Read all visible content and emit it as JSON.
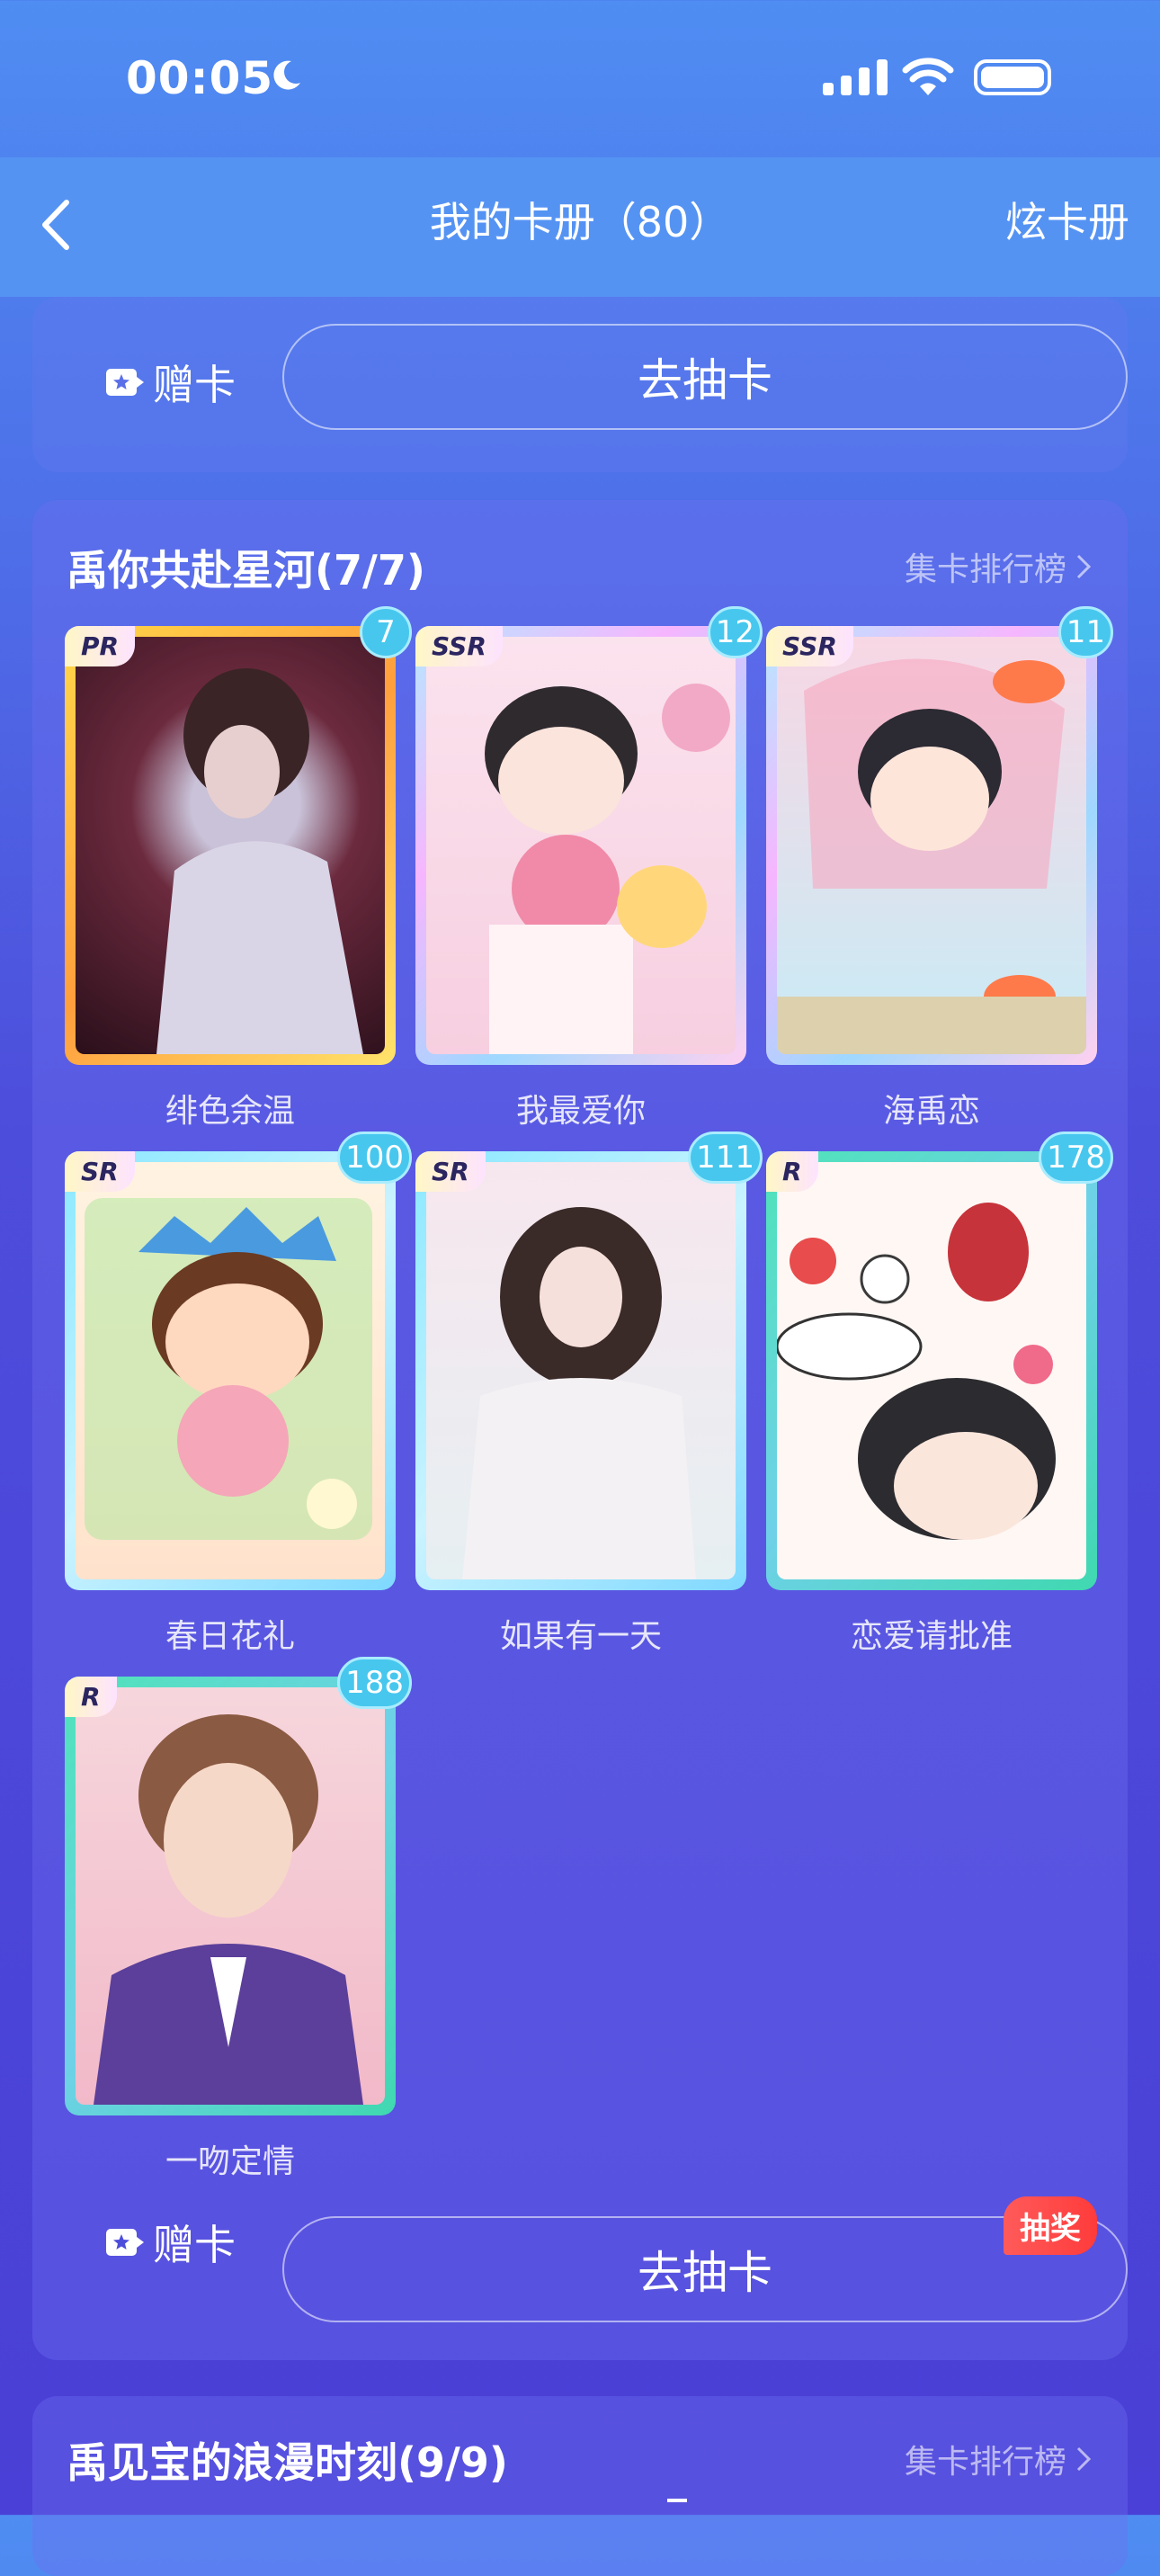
{
  "status": {
    "time": "00:05"
  },
  "nav": {
    "title": "我的卡册（80）",
    "right": "炫卡册"
  },
  "top_actions": {
    "gift": "赠卡",
    "draw": "去抽卡"
  },
  "section1": {
    "title": "禹你共赴星河(7/7)",
    "rank": "集卡排行榜",
    "cards": [
      {
        "name": "绯色余温",
        "rarity": "PR",
        "count": "7"
      },
      {
        "name": "我最爱你",
        "rarity": "SSR",
        "count": "12"
      },
      {
        "name": "海禹恋",
        "rarity": "SSR",
        "count": "11"
      },
      {
        "name": "春日花礼",
        "rarity": "SR",
        "count": "100"
      },
      {
        "name": "如果有一天",
        "rarity": "SR",
        "count": "111"
      },
      {
        "name": "恋爱请批准",
        "rarity": "R",
        "count": "178"
      },
      {
        "name": "一吻定情",
        "rarity": "R",
        "count": "188"
      }
    ],
    "gift": "赠卡",
    "draw": "去抽卡",
    "draw_badge": "抽奖"
  },
  "section2": {
    "title": "禹见宝的浪漫时刻(9/9)",
    "rank": "集卡排行榜"
  },
  "colors": {
    "accent": "#47c7ee",
    "badge": "#ff3b3b",
    "nav": "#5593f3"
  }
}
